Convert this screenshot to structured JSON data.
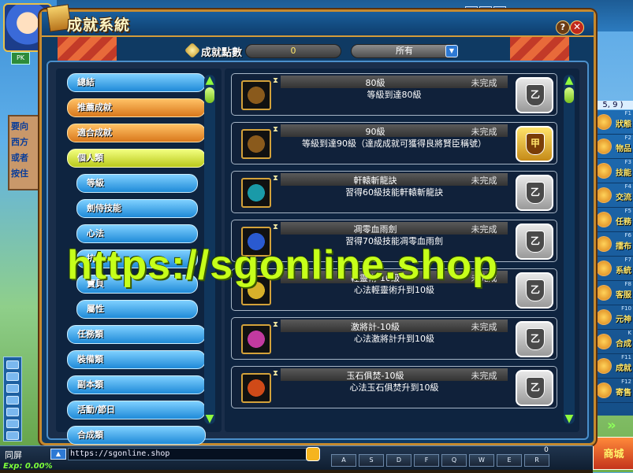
{
  "window": {
    "title": "成就系統",
    "help": "?",
    "close": "✕"
  },
  "points": {
    "label": "成就點數",
    "value": "0",
    "filter": "所有"
  },
  "categories": [
    {
      "label": "總結",
      "style": "blue"
    },
    {
      "label": "推薦成就",
      "style": "orange"
    },
    {
      "label": "適合成就",
      "style": "orange"
    },
    {
      "label": "個人類",
      "style": "yellow"
    },
    {
      "label": "等級",
      "style": "blue-sub"
    },
    {
      "label": "劍侍技能",
      "style": "blue-sub"
    },
    {
      "label": "心法",
      "style": "blue-sub"
    },
    {
      "label": "抗性",
      "style": "blue-sub"
    },
    {
      "label": "寶貝",
      "style": "blue-sub"
    },
    {
      "label": "屬性",
      "style": "blue-sub"
    },
    {
      "label": "任務類",
      "style": "blue"
    },
    {
      "label": "裝備類",
      "style": "blue"
    },
    {
      "label": "副本類",
      "style": "blue"
    },
    {
      "label": "活動/節日",
      "style": "blue"
    },
    {
      "label": "合成類",
      "style": "blue"
    }
  ],
  "achievements": [
    {
      "name": "80級",
      "status": "未完成",
      "desc": "等級到達80級",
      "badge": "乙",
      "badge_color": "#9a9a9a",
      "icon_color": "#8a5a1c"
    },
    {
      "name": "90級",
      "status": "未完成",
      "desc": "等級到達90級（達成成就可獲得良將賢臣稱號）",
      "badge": "甲",
      "badge_color": "#c58a18",
      "icon_color": "#8a5a1c"
    },
    {
      "name": "軒轅斬龍訣",
      "status": "未完成",
      "desc": "習得60級技能軒轅斬龍訣",
      "badge": "乙",
      "badge_color": "#9a9a9a",
      "icon_color": "#1a9aa8"
    },
    {
      "name": "凋零血雨劍",
      "status": "未完成",
      "desc": "習得70級技能凋零血雨劍",
      "badge": "乙",
      "badge_color": "#9a9a9a",
      "icon_color": "#2a5ad0"
    },
    {
      "name": "輕靈術-10級",
      "status": "未完成",
      "desc": "心法輕靈術升到10級",
      "badge": "乙",
      "badge_color": "#9a9a9a",
      "icon_color": "#d8b02a"
    },
    {
      "name": "激將計-10級",
      "status": "未完成",
      "desc": "心法激將計升到10級",
      "badge": "乙",
      "badge_color": "#9a9a9a",
      "icon_color": "#c23aa0"
    },
    {
      "name": "玉石俱焚-10級",
      "status": "未完成",
      "desc": "心法玉石俱焚升到10級",
      "badge": "乙",
      "badge_color": "#9a9a9a",
      "icon_color": "#d04a18"
    }
  ],
  "watermark": "https://sgonline.shop",
  "left_sign": [
    "要向",
    "西方",
    "或者",
    "按住"
  ],
  "coord": "5, 9 )",
  "right_menu": [
    {
      "key": "F1",
      "label": "狀態"
    },
    {
      "key": "F2",
      "label": "物品"
    },
    {
      "key": "F3",
      "label": "技能"
    },
    {
      "key": "F4",
      "label": "交流"
    },
    {
      "key": "F5",
      "label": "任務"
    },
    {
      "key": "F6",
      "label": "擂布"
    },
    {
      "key": "F7",
      "label": "系統"
    },
    {
      "key": "F8",
      "label": "客服"
    },
    {
      "key": "F10",
      "label": "元神"
    },
    {
      "key": "K",
      "label": "合成"
    },
    {
      "key": "F11",
      "label": "成就"
    },
    {
      "key": "F12",
      "label": "寄售"
    }
  ],
  "shop_label": "商城",
  "bottom": {
    "channel": "同屏",
    "chat_text": "https://sgonline.shop",
    "exp_label": "Exp: 0.00%",
    "hotkeys": [
      "A",
      "S",
      "D",
      "F",
      "Q",
      "W",
      "E",
      "R"
    ],
    "page": "0"
  }
}
